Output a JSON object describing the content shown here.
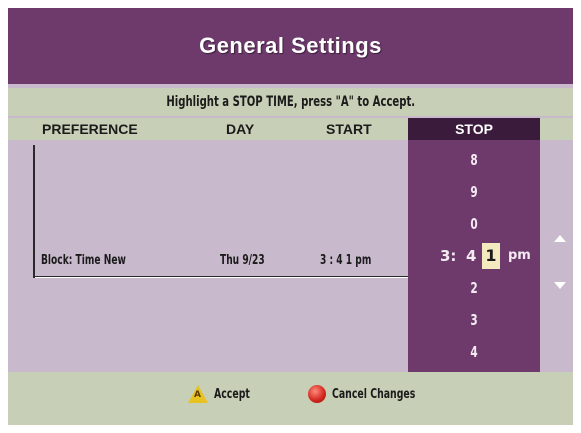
{
  "header": {
    "title": "General Settings"
  },
  "instruction": "Highlight a STOP TIME, press \"A\" to Accept.",
  "columns": {
    "preference": "PREFERENCE",
    "day": "DAY",
    "start": "START",
    "stop": "STOP"
  },
  "row": {
    "preference": "Block: Time New",
    "day": "Thu 9/23",
    "start": "3 : 4 1 pm"
  },
  "stop_picker": {
    "above": [
      "8",
      "9",
      "0"
    ],
    "hour": "3:",
    "tens": "4",
    "selected": "1",
    "meridiem": "pm",
    "below": [
      "2",
      "3",
      "4"
    ]
  },
  "footer": {
    "accept_label": "Accept",
    "cancel_label": "Cancel Changes",
    "accept_icon_letter": "A"
  },
  "colors": {
    "header": "#6d3a6b",
    "panel": "#c9b9cd",
    "bar": "#c7d0b6",
    "stop_dark": "#3b1b3c"
  }
}
